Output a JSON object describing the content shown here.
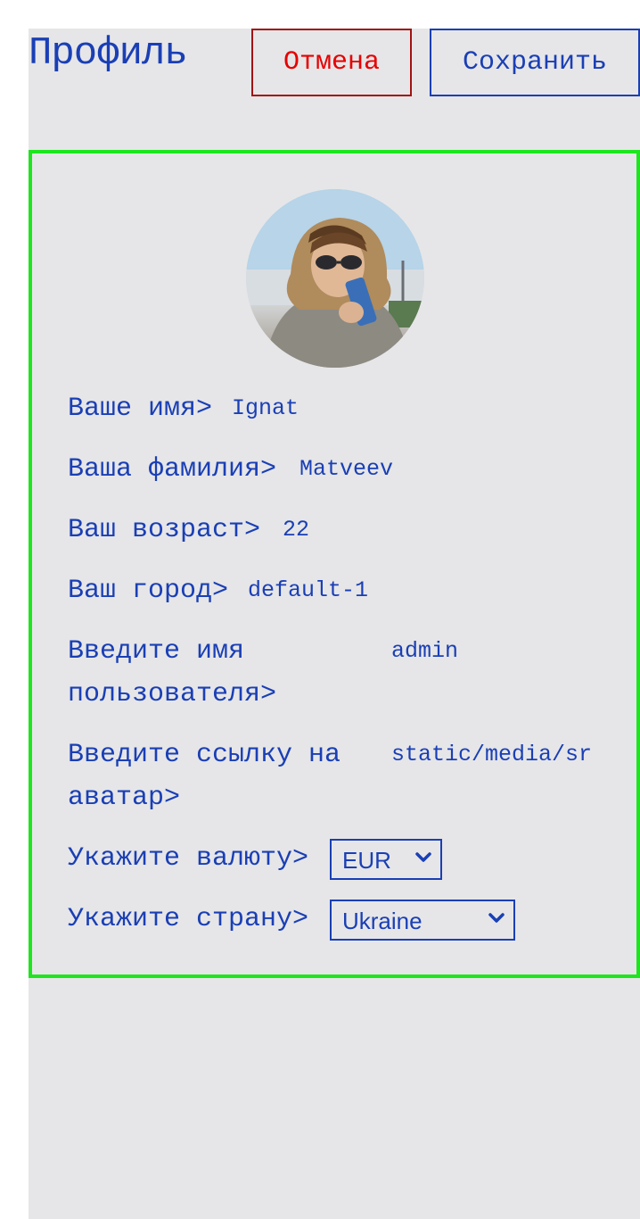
{
  "header": {
    "title": "Профиль",
    "cancel_label": "Отмена",
    "save_label": "Сохранить"
  },
  "profile": {
    "avatar_alt": "avatar",
    "fields": [
      {
        "label": "Ваше имя>",
        "value": "Ignat"
      },
      {
        "label": "Ваша фамилия>",
        "value": "Matveev"
      },
      {
        "label": "Ваш возраст>",
        "value": "22"
      },
      {
        "label": "Ваш город>",
        "value": "default-1"
      },
      {
        "label": "Введите имя пользователя>",
        "value": "admin"
      },
      {
        "label": "Введите ссылку на аватар>",
        "value": "static/media/sr"
      }
    ],
    "currency": {
      "label": "Укажите валюту>",
      "selected": "EUR"
    },
    "country": {
      "label": "Укажите страну>",
      "selected": "Ukraine"
    }
  },
  "colors": {
    "text": "#1a3fb5",
    "cancel_text": "#e60000",
    "cancel_border": "#a01414",
    "card_border": "#1ee61e",
    "page_background": "#e6e6e8"
  },
  "icons": {
    "select_arrow": "chevron-down-icon"
  }
}
